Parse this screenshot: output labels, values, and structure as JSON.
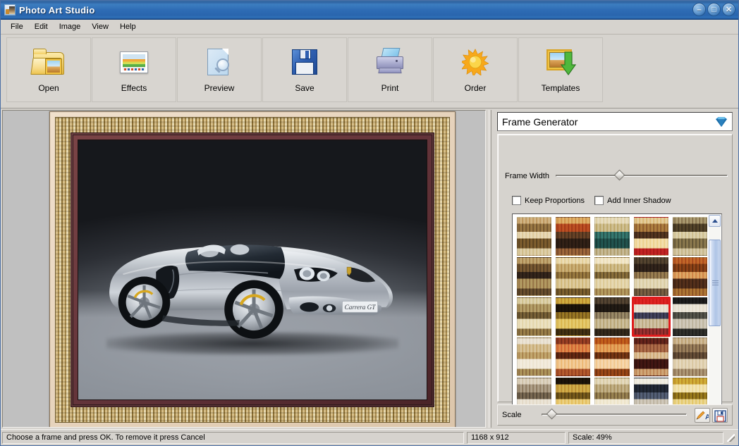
{
  "window": {
    "title": "Photo Art Studio",
    "icon": "app-photo-icon",
    "controls": [
      {
        "name": "minimize-button",
        "glyph": "–"
      },
      {
        "name": "maximize-button",
        "glyph": "□"
      },
      {
        "name": "close-button",
        "glyph": "✕"
      }
    ]
  },
  "menubar": {
    "items": [
      {
        "label": "File"
      },
      {
        "label": "Edit"
      },
      {
        "label": "Image"
      },
      {
        "label": "View"
      },
      {
        "label": "Help"
      }
    ]
  },
  "toolbar": {
    "buttons": [
      {
        "label": "Open",
        "icon": "open-folder-icon"
      },
      {
        "label": "Effects",
        "icon": "effects-picture-icon"
      },
      {
        "label": "Preview",
        "icon": "preview-magnifier-icon"
      },
      {
        "label": "Save",
        "icon": "save-floppy-icon"
      },
      {
        "label": "Print",
        "icon": "print-printer-icon"
      },
      {
        "label": "Order",
        "icon": "order-sun-icon"
      },
      {
        "label": "Templates",
        "icon": "templates-picture-arrow-icon"
      }
    ]
  },
  "canvas": {
    "image_subject": "Silver Porsche Carrera GT convertible on gray studio backdrop",
    "plate_text": "Carrera GT",
    "frame_style": "ornate gold-and-maroon decorative frame"
  },
  "panel": {
    "combo_label": "Frame Generator",
    "combo_icon": "blue-gem-icon",
    "frame_width": {
      "label": "Frame Width",
      "value_percent": 37
    },
    "checkboxes": [
      {
        "label": "Keep Proportions",
        "checked": false
      },
      {
        "label": "Add Inner Shadow",
        "checked": false
      }
    ],
    "scrollbar": {
      "up_icon": "chevron-up-icon",
      "down_icon": "chevron-down-icon",
      "thumb_top_percent": 6,
      "thumb_height_percent": 43
    },
    "scale": {
      "label": "Scale",
      "value_percent": 7
    },
    "mini_buttons": [
      {
        "name": "rename-frame-button",
        "icon": "pencil-a-icon"
      },
      {
        "name": "save-frame-button",
        "icon": "blue-disk-icon"
      }
    ],
    "thumbnails": [
      {
        "id": 1,
        "colors": [
          "#c9a874",
          "#8a6a3c",
          "#e3d2ab",
          "#6e5228",
          "#d8c79c"
        ],
        "selected": false
      },
      {
        "id": 2,
        "colors": [
          "#d8a45c",
          "#b2471f",
          "#5c3a22",
          "#2c1d14",
          "#8d5a34"
        ],
        "selected": false
      },
      {
        "id": 3,
        "colors": [
          "#e3d7b4",
          "#c7b581",
          "#2f6a62",
          "#1d4a46",
          "#bdae85"
        ],
        "selected": false
      },
      {
        "id": 4,
        "colors": [
          "#e0c48a",
          "#a07038",
          "#4a2f1c",
          "#f0d9a0",
          "#b81f1f"
        ],
        "selected": false
      },
      {
        "id": 5,
        "colors": [
          "#9c8a62",
          "#4a3c24",
          "#d6c9a0",
          "#7a6a44",
          "#cfc19a"
        ],
        "selected": false
      },
      {
        "id": 6,
        "colors": [
          "#b89a64",
          "#6a4e2c",
          "#2e2118",
          "#a68a56",
          "#5c4428"
        ],
        "selected": false
      },
      {
        "id": 7,
        "colors": [
          "#e8d6a8",
          "#c2a469",
          "#8a6c38",
          "#d8c38e",
          "#6e5428"
        ],
        "selected": false
      },
      {
        "id": 8,
        "colors": [
          "#f0e4c4",
          "#c9b47e",
          "#7a6234",
          "#e2d2a6",
          "#a88c54"
        ],
        "selected": false
      },
      {
        "id": 9,
        "colors": [
          "#4a3c2a",
          "#2c2018",
          "#8a7048",
          "#e0d4b0",
          "#6a543a"
        ],
        "selected": false
      },
      {
        "id": 10,
        "colors": [
          "#b85c24",
          "#7c3a14",
          "#d89858",
          "#4a2a18",
          "#a0682e"
        ],
        "selected": false
      },
      {
        "id": 11,
        "colors": [
          "#d8cba0",
          "#a8905c",
          "#6a5530",
          "#e8dcb8",
          "#8a7040"
        ],
        "selected": false
      },
      {
        "id": 12,
        "colors": [
          "#c8a038",
          "#1a1208",
          "#8a6a20",
          "#e0c260",
          "#3c2c10"
        ],
        "selected": false
      },
      {
        "id": 13,
        "colors": [
          "#4a3c2c",
          "#1e1812",
          "#8a7a5c",
          "#c4b48c",
          "#2e2418"
        ],
        "selected": false
      },
      {
        "id": 14,
        "colors": [
          "#d82020",
          "#e8e0d0",
          "#3a3a52",
          "#c8b896",
          "#8a2a2a"
        ],
        "selected": true
      },
      {
        "id": 15,
        "colors": [
          "#1a1a1a",
          "#e8e2d4",
          "#4a4a42",
          "#c8c0ae",
          "#2a2a26"
        ],
        "selected": false
      },
      {
        "id": 16,
        "colors": [
          "#e8e0d0",
          "#d0b888",
          "#b89860",
          "#f0e8d8",
          "#a08450"
        ],
        "selected": false
      },
      {
        "id": 17,
        "colors": [
          "#8a3820",
          "#d87a40",
          "#5a2410",
          "#f0c48a",
          "#a85028"
        ],
        "selected": false
      },
      {
        "id": 18,
        "colors": [
          "#b85418",
          "#e09850",
          "#6a3010",
          "#f4d0a0",
          "#8a3e14"
        ],
        "selected": false
      },
      {
        "id": 19,
        "colors": [
          "#5a2018",
          "#a06040",
          "#d8b88c",
          "#3a1410",
          "#c89868"
        ],
        "selected": false
      },
      {
        "id": 20,
        "colors": [
          "#c8b088",
          "#8a7050",
          "#5a4430",
          "#e0d0b0",
          "#a08868"
        ],
        "selected": false
      },
      {
        "id": 21,
        "colors": [
          "#d8cdb8",
          "#a09078",
          "#6a5c48",
          "#e8e0d0",
          "#8a7a60"
        ],
        "selected": false
      },
      {
        "id": 22,
        "colors": [
          "#1a1208",
          "#c8a040",
          "#6a5018",
          "#e8c870",
          "#2a2010"
        ],
        "selected": false
      },
      {
        "id": 23,
        "colors": [
          "#e0d4b4",
          "#b8a478",
          "#8a7448",
          "#f0e8d0",
          "#a08c58"
        ],
        "selected": false
      },
      {
        "id": 24,
        "colors": [
          "#f0ece0",
          "#1e2430",
          "#4a5468",
          "#c8c0b0",
          "#2a3240"
        ],
        "selected": false
      },
      {
        "id": 25,
        "colors": [
          "#c8a030",
          "#f0e0a8",
          "#8a6c18",
          "#e8d080",
          "#a88830"
        ],
        "selected": false
      }
    ]
  },
  "statusbar": {
    "message": "Choose a frame and press OK. To remove it press Cancel",
    "dimensions": "1168 x 912",
    "scale": "Scale: 49%"
  }
}
